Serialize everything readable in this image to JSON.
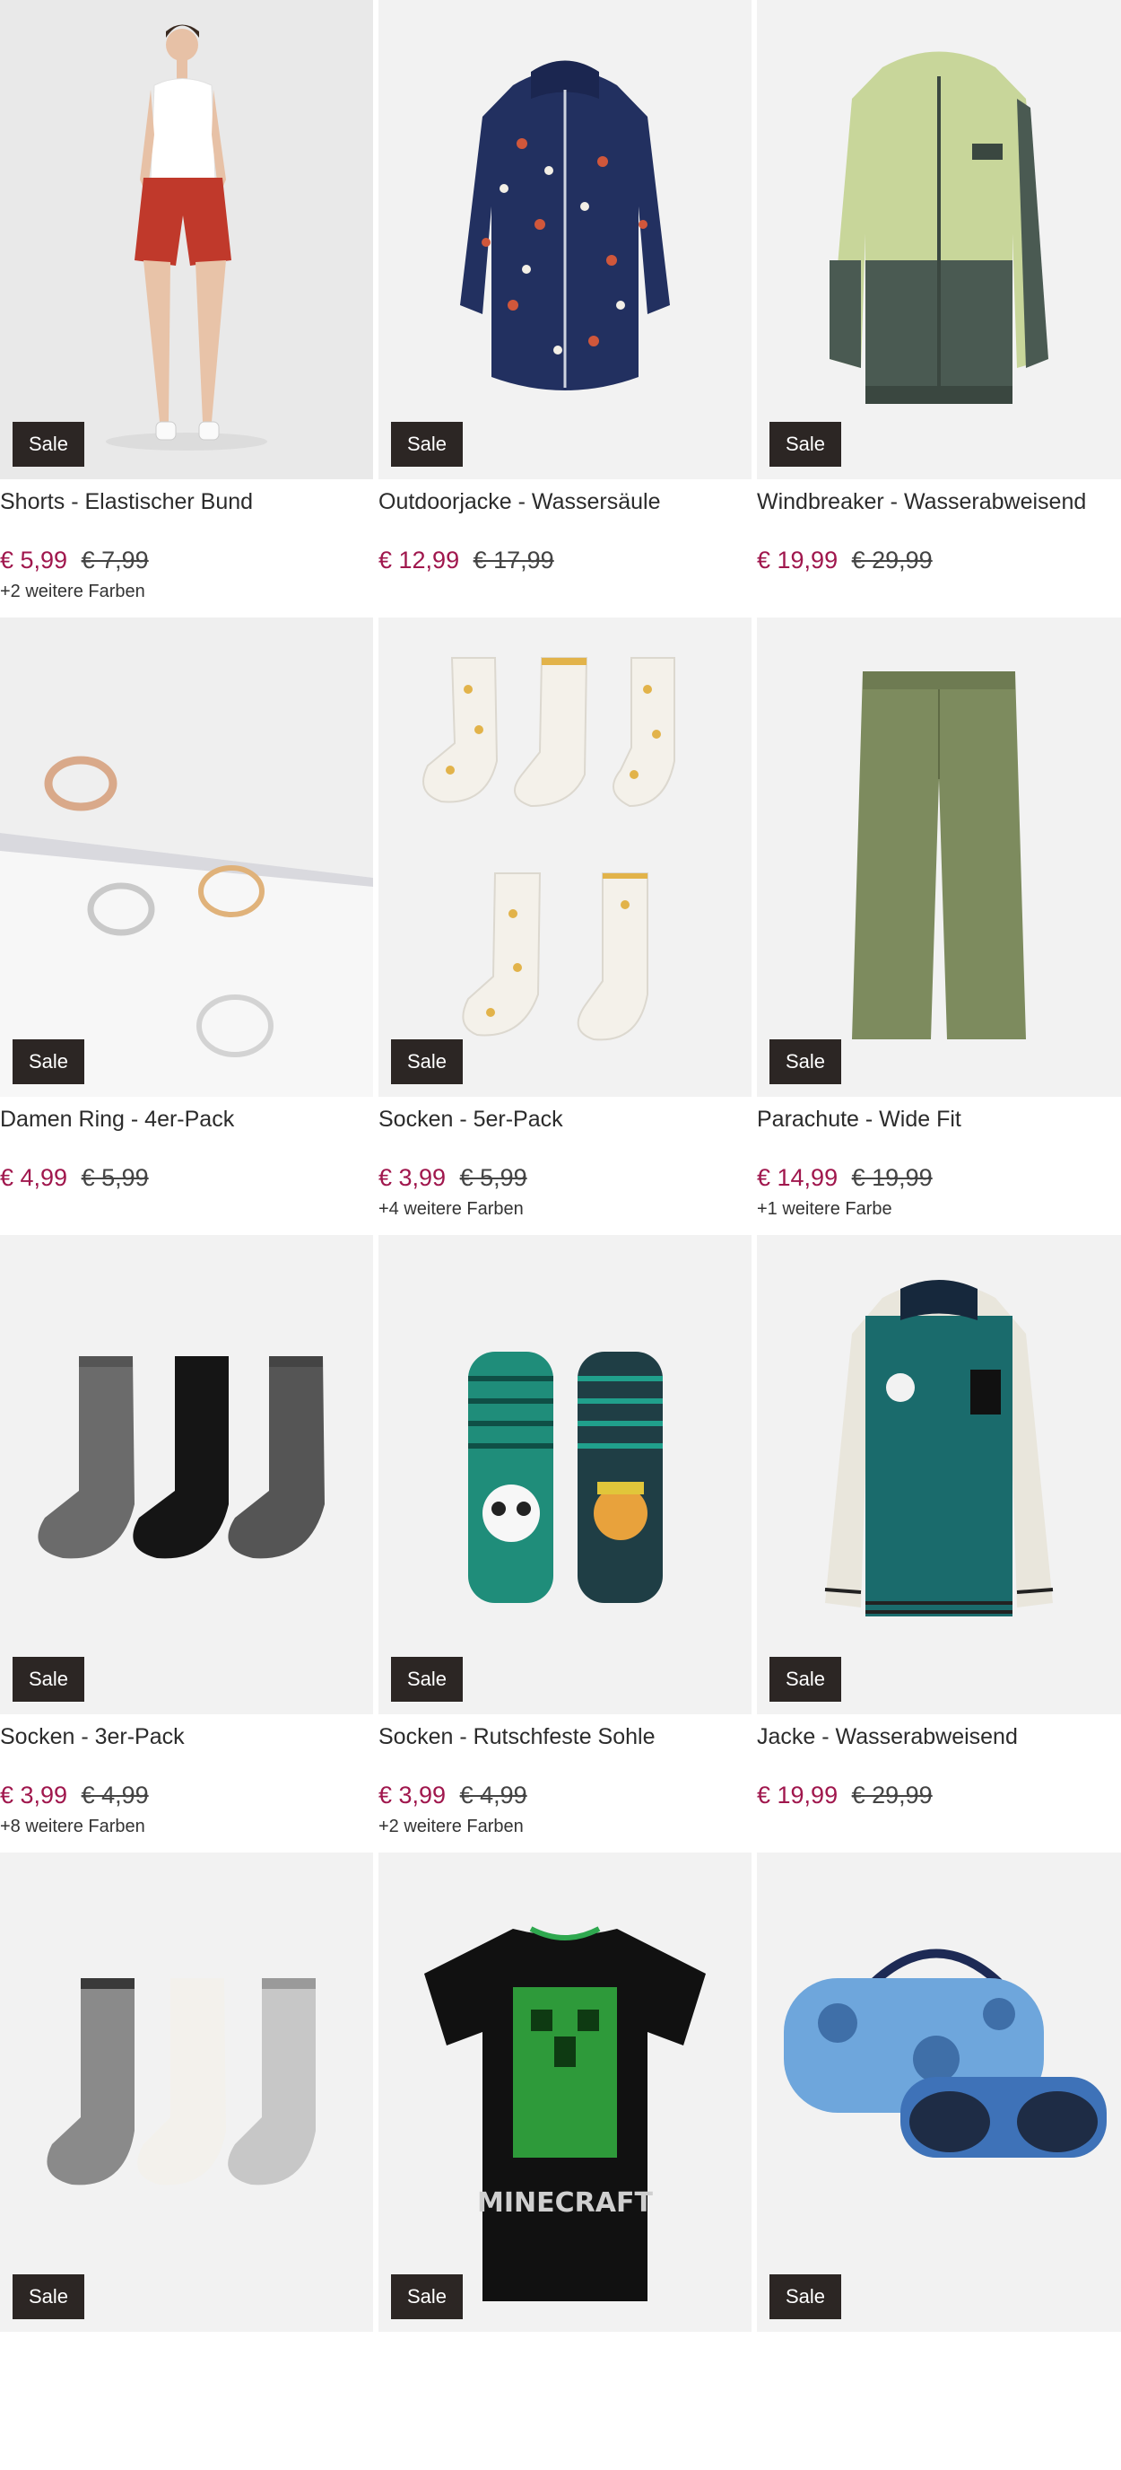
{
  "products": [
    {
      "badge": "Sale",
      "title": "Shorts - Elastischer Bund",
      "price": "€ 5,99",
      "old_price": "€ 7,99",
      "colors": "+2 weitere Farben",
      "image": "woman-red-shorts"
    },
    {
      "badge": "Sale",
      "title": "Outdoorjacke - Wassersäule",
      "price": "€ 12,99",
      "old_price": "€ 17,99",
      "colors": "",
      "image": "navy-patterned-rain-jacket"
    },
    {
      "badge": "Sale",
      "title": "Windbreaker - Wasserabweisend",
      "price": "€ 19,99",
      "old_price": "€ 29,99",
      "colors": "",
      "image": "green-windbreaker-jacket"
    },
    {
      "badge": "Sale",
      "title": "Damen Ring - 4er-Pack",
      "price": "€ 4,99",
      "old_price": "€ 5,99",
      "colors": "",
      "image": "four-rings"
    },
    {
      "badge": "Sale",
      "title": "Socken - 5er-Pack",
      "price": "€ 3,99",
      "old_price": "€ 5,99",
      "colors": "+4 weitere Farben",
      "image": "star-socks-five-pack"
    },
    {
      "badge": "Sale",
      "title": "Parachute - Wide Fit",
      "price": "€ 14,99",
      "old_price": "€ 19,99",
      "colors": "+1 weitere Farbe",
      "image": "olive-parachute-pants"
    },
    {
      "badge": "Sale",
      "title": "Socken - 3er-Pack",
      "price": "€ 3,99",
      "old_price": "€ 4,99",
      "colors": "+8 weitere Farben",
      "image": "grey-black-socks"
    },
    {
      "badge": "Sale",
      "title": "Socken - Rutschfeste Sohle",
      "price": "€ 3,99",
      "old_price": "€ 4,99",
      "colors": "+2 weitere Farben",
      "image": "panda-tiger-socks"
    },
    {
      "badge": "Sale",
      "title": "Jacke - Wasserabweisend",
      "price": "€ 19,99",
      "old_price": "€ 29,99",
      "colors": "",
      "image": "teal-college-jacket"
    },
    {
      "badge": "Sale",
      "title": "",
      "price": "",
      "old_price": "",
      "colors": "",
      "image": "herringbone-socks"
    },
    {
      "badge": "Sale",
      "title": "",
      "price": "",
      "old_price": "",
      "colors": "",
      "image": "minecraft-tshirt",
      "print": "MINECRAFT"
    },
    {
      "badge": "Sale",
      "title": "",
      "price": "",
      "old_price": "",
      "colors": "",
      "image": "sunglasses-with-case"
    }
  ],
  "colors": {
    "price": "#a0174d",
    "badge_bg": "#2c2624",
    "image_bg": "#f2f2f2"
  }
}
